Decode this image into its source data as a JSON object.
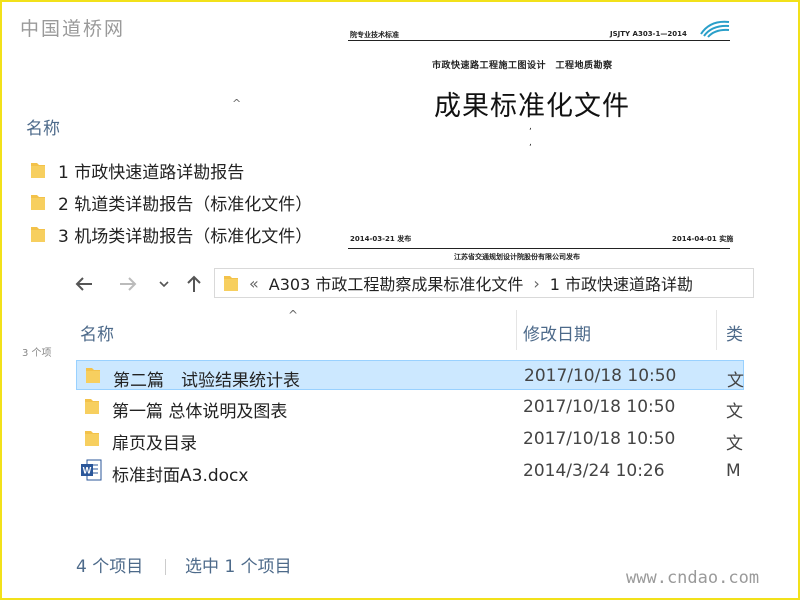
{
  "site_logo": "中国道桥网",
  "back_window": {
    "column_name": "名称",
    "items": [
      {
        "label": "1 市政快速道路详勘报告"
      },
      {
        "label": "2 轨道类详勘报告（标准化文件）"
      },
      {
        "label": "3 机场类详勘报告（标准化文件）"
      }
    ],
    "truncated_status": "3 个项"
  },
  "doc": {
    "header_left": "院专业技术标准",
    "header_right": "JSJTY A303-1—2014",
    "subtitle": "市政快速路工程施工图设计　工程地质勘察",
    "title": "成果标准化文件",
    "footer_left": "2014-03-21 发布",
    "footer_right": "2014-04-01 实施",
    "publisher": "江苏省交通规划设计院股份有限公司发布"
  },
  "explorer": {
    "breadcrumb": [
      "«",
      "A303 市政工程勘察成果标准化文件",
      "1 市政快速道路详勘"
    ],
    "columns": {
      "name": "名称",
      "date": "修改日期",
      "type": "类"
    },
    "rows": [
      {
        "name": "第二篇　试验结果统计表",
        "date": "2017/10/18 10:50",
        "type": "文",
        "icon": "folder-icon",
        "selected": true
      },
      {
        "name": "第一篇  总体说明及图表",
        "date": "2017/10/18 10:50",
        "type": "文",
        "icon": "folder-icon",
        "selected": false
      },
      {
        "name": "扉页及目录",
        "date": "2017/10/18 10:50",
        "type": "文",
        "icon": "folder-icon",
        "selected": false
      },
      {
        "name": "标准封面A3.docx",
        "date": "2014/3/24 10:26",
        "type": "M",
        "icon": "word-doc-icon",
        "selected": false
      }
    ],
    "status_count": "4 个项目",
    "status_selected": "选中 1 个项目"
  },
  "watermark": "www.cndao.com",
  "colors": {
    "folder": "#f3c24a",
    "selection": "#cce8ff",
    "header_text": "#4d6a8a",
    "frame": "#f2e11a"
  }
}
